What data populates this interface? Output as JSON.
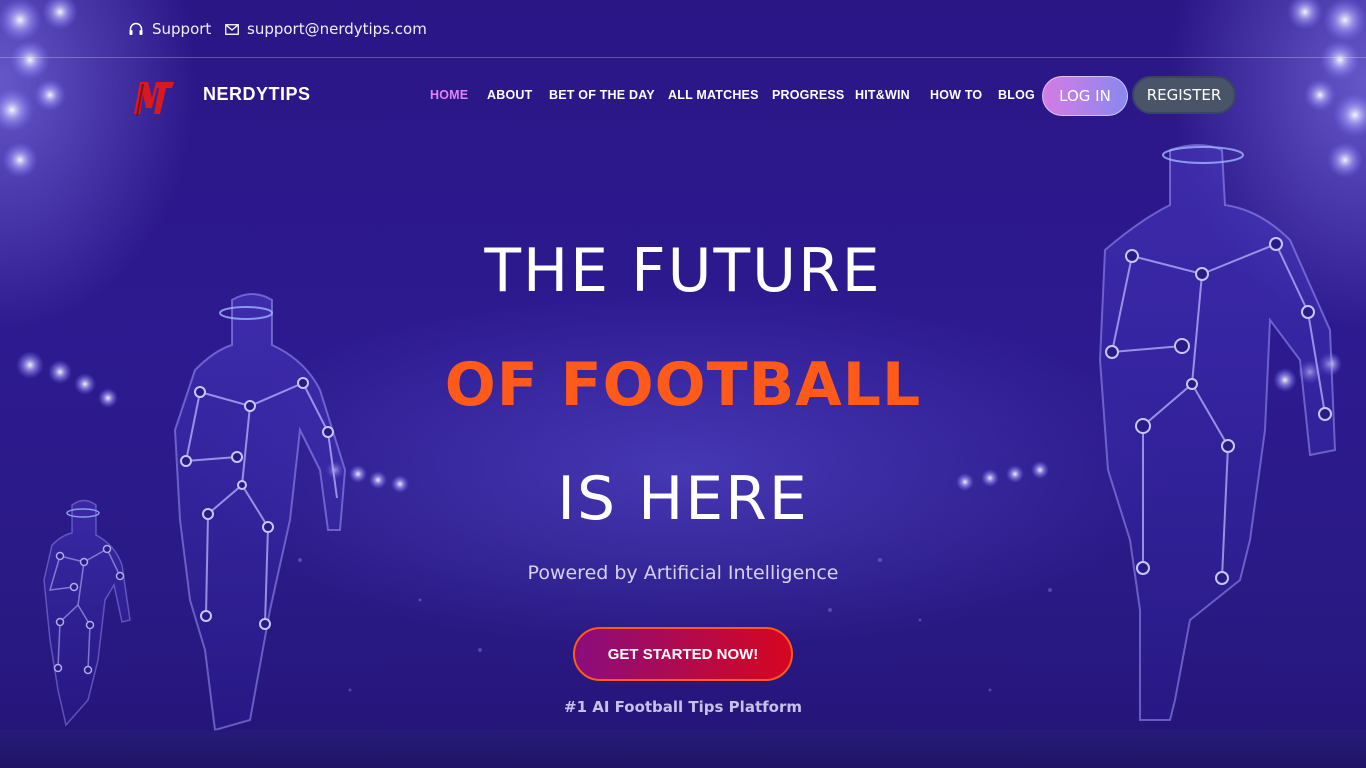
{
  "topbar": {
    "support_label": "Support",
    "support_icon": "headset-icon",
    "email": "support@nerdytips.com",
    "email_icon": "envelope-icon"
  },
  "nav": {
    "brand": "NERDYTIPS",
    "logo": "nerdytips-logo",
    "menu": [
      {
        "label": "HOME",
        "active": true
      },
      {
        "label": "ABOUT"
      },
      {
        "label": "BET OF THE DAY"
      },
      {
        "label": "ALL MATCHES"
      },
      {
        "label": "PROGRESS"
      },
      {
        "label": "HIT&WIN"
      },
      {
        "label": "HOW TO"
      },
      {
        "label": "BLOG"
      }
    ],
    "login_label": "LOG IN",
    "register_label": "REGISTER"
  },
  "hero": {
    "line1": "THE FUTURE",
    "line2": "OF FOOTBALL",
    "line3": "IS HERE",
    "subtitle": "Powered by Artificial Intelligence",
    "cta_label": "GET STARTED NOW!",
    "tagline": "#1 AI Football Tips Platform"
  },
  "colors": {
    "background": "#2a1683",
    "accent_orange": "#ff5a1a",
    "active_menu": "#e184f0",
    "cta_start": "#8a0d7e",
    "cta_end": "#d7061f"
  }
}
